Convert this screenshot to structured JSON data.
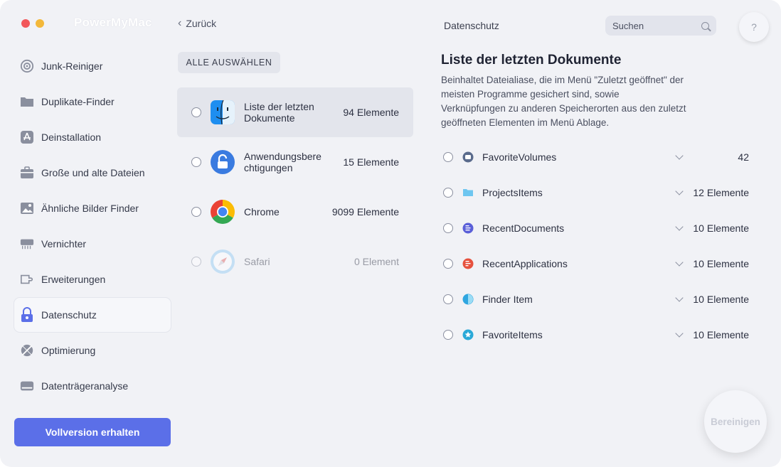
{
  "app": {
    "brand": "PowerMyMac"
  },
  "header": {
    "back_label": "Zurück",
    "section_title": "Datenschutz",
    "search_placeholder": "Suchen",
    "help_label": "?"
  },
  "sidebar": {
    "items": [
      {
        "label": "Junk-Reiniger",
        "icon": "gear-icon"
      },
      {
        "label": "Duplikate-Finder",
        "icon": "folder-icon"
      },
      {
        "label": "Deinstallation",
        "icon": "appstore-icon"
      },
      {
        "label": "Große und alte Dateien",
        "icon": "briefcase-icon"
      },
      {
        "label": "Ähnliche Bilder Finder",
        "icon": "image-icon"
      },
      {
        "label": "Vernichter",
        "icon": "shredder-icon"
      },
      {
        "label": "Erweiterungen",
        "icon": "plugin-icon"
      },
      {
        "label": "Datenschutz",
        "icon": "lock-icon"
      },
      {
        "label": "Optimierung",
        "icon": "satellite-icon"
      },
      {
        "label": "Datenträgeranalyse",
        "icon": "disk-icon"
      }
    ],
    "active_index": 7,
    "upgrade_label": "Vollversion erhalten"
  },
  "middle": {
    "select_all_label": "ALLE AUSWÄHLEN",
    "items": [
      {
        "name": "Liste der letzten Dokumente",
        "count": "94 Elemente",
        "icon": "finder-icon"
      },
      {
        "name": "Anwendungsbere chtigungen",
        "count": "15 Elemente",
        "icon": "permissions-lock-icon"
      },
      {
        "name": "Chrome",
        "count": "9099 Elemente",
        "icon": "chrome-icon"
      },
      {
        "name": "Safari",
        "count": "0 Element",
        "icon": "safari-icon"
      }
    ]
  },
  "detail": {
    "title": "Liste der letzten Dokumente",
    "description": "Beinhaltet Dateialiase, die im Menü \"Zuletzt geöffnet\" der meisten Programme gesichert sind, sowie Verknüpfungen zu anderen Speicherorten aus den zuletzt geöffneten Elementen im Menü Ablage.",
    "items": [
      {
        "name": "FavoriteVolumes",
        "count": "42",
        "icon": "volume-icon",
        "color": "#5a6b8c"
      },
      {
        "name": "ProjectsItems",
        "count": "12 Elemente",
        "icon": "folder-icon",
        "color": "#6ec6f0"
      },
      {
        "name": "RecentDocuments",
        "count": "10 Elemente",
        "icon": "document-icon",
        "color": "#5a5fd8"
      },
      {
        "name": "RecentApplications",
        "count": "10 Elemente",
        "icon": "application-icon",
        "color": "#e6513e"
      },
      {
        "name": "Finder Item",
        "count": "10 Elemente",
        "icon": "finder-item-icon",
        "color": "#2fa6e0"
      },
      {
        "name": "FavoriteItems",
        "count": "10 Elemente",
        "icon": "star-icon",
        "color": "#2aa9d8"
      }
    ]
  },
  "actions": {
    "clean_label": "Bereinigen"
  },
  "colors": {
    "accent": "#5b6fe8",
    "background": "#f1f2f6"
  }
}
